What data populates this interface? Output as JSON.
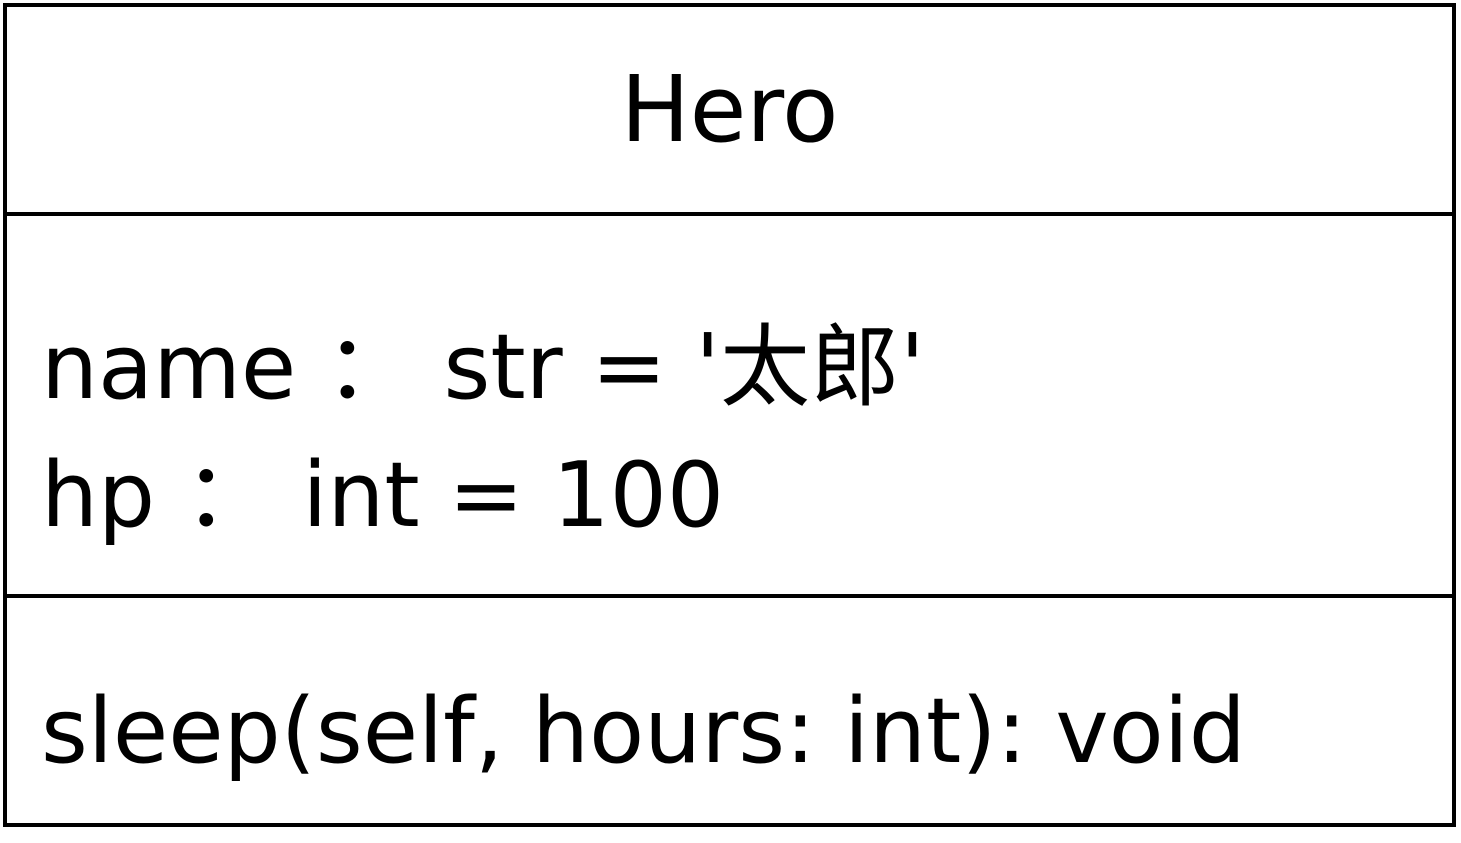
{
  "class": {
    "name": "Hero",
    "attributes": [
      {
        "text": "name ： str = '太郎'"
      },
      {
        "text": "hp ： int = 100"
      }
    ],
    "methods": [
      {
        "text": "sleep(self, hours: int): void"
      }
    ]
  }
}
